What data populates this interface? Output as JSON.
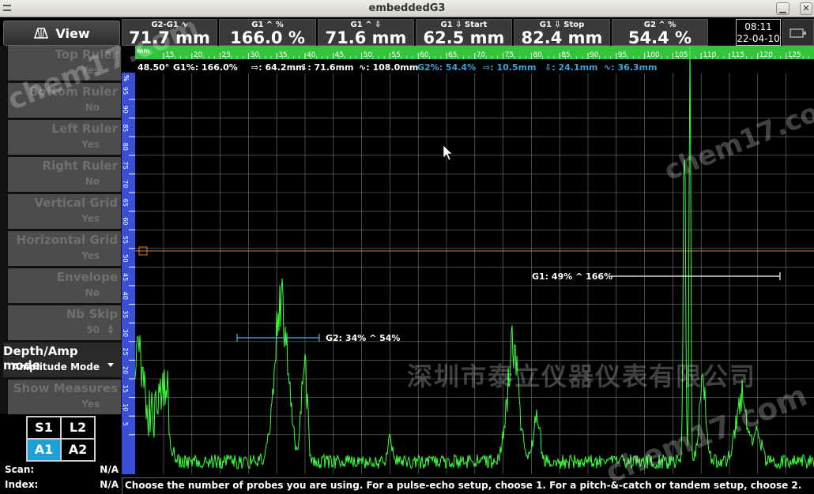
{
  "window": {
    "title": "embeddedG3"
  },
  "view_button": {
    "label": "View"
  },
  "readings": [
    {
      "label": "G2-G1 ∿",
      "value": "71.7 mm"
    },
    {
      "label": "G1 ^ %",
      "value": "166.0 %"
    },
    {
      "label": "G1 ^ ⇩",
      "value": "71.6 mm"
    },
    {
      "label": "G1 ⇩ Start",
      "value": "62.5 mm"
    },
    {
      "label": "G1 ⇩ Stop",
      "value": "82.4 mm"
    },
    {
      "label": "G2 ^ %",
      "value": "54.4 %"
    }
  ],
  "clock": {
    "time": "08:11",
    "date": "22-04-10"
  },
  "menu": [
    {
      "label": "Top Ruler",
      "value": "Yes"
    },
    {
      "label": "Bottom Ruler",
      "value": "No"
    },
    {
      "label": "Left Ruler",
      "value": "Yes"
    },
    {
      "label": "Right Ruler",
      "value": "No"
    },
    {
      "label": "Vertical Grid",
      "value": "Yes"
    },
    {
      "label": "Horizontal Grid",
      "value": "Yes"
    },
    {
      "label": "Envelope",
      "value": "No"
    },
    {
      "label": "Nb Skip",
      "value": "50"
    },
    {
      "label": "Depth/Amp mode",
      "value": "Amplitude Mode"
    },
    {
      "label": "Show Measures",
      "value": "Yes"
    }
  ],
  "probes": {
    "buttons": [
      "S1",
      "L2",
      "A1",
      "A2"
    ],
    "selected": "A1"
  },
  "info": {
    "scan_label": "Scan:",
    "scan_value": "N/A",
    "index_label": "Index:",
    "index_value": "N/A"
  },
  "status_message": "Choose the number of probes you are using. For a pulse-echo setup, choose 1. For a pitch-&-catch or tandem setup, choose 2.",
  "measures": {
    "angle": "48.50°",
    "g1_amp": "G1%: 166.0%",
    "g1_sound_path": "⇨: 64.2mm",
    "g1_depth": "⇩: 71.6mm",
    "g1_distance": "∿: 108.0mm",
    "g2_amp": "G2%: 54.4%",
    "g2_sound_path": "⇨: 10.5mm",
    "g2_depth": "⇩: 24.1mm",
    "g2_distance": "∿: 36.3mm"
  },
  "top_ruler": {
    "unit": "mm",
    "ticks": [
      "15",
      "20",
      "25",
      "30",
      "35",
      "40",
      "45",
      "50",
      "55",
      "60",
      "65",
      "70",
      "75",
      "80",
      "85",
      "90",
      "95",
      "100",
      "105",
      "110",
      "115",
      "120",
      "125"
    ]
  },
  "left_ruler": {
    "unit": "%",
    "ticks": [
      "95",
      "90",
      "85",
      "80",
      "75",
      "70",
      "65",
      "60",
      "55",
      "50",
      "45",
      "40",
      "35",
      "30",
      "25",
      "20",
      "15",
      "10",
      "5"
    ]
  },
  "gates": {
    "g1": {
      "label": "G1: 49% ^ 166%",
      "color": "#ffffff"
    },
    "g2": {
      "label": "G2: 34% ^ 54%",
      "color": "#4fb3e8"
    }
  },
  "colors": {
    "ruler_green": "#33c43c",
    "ruler_blue": "#3b4fd6",
    "signal": "#3bff3b",
    "reference_line": "#d08040",
    "measure_white": "#ffffff",
    "measure_blue": "#3aa3d6"
  },
  "watermarks": [
    "chem17.com",
    "深圳市泰立仪器仪表有限公司"
  ]
}
